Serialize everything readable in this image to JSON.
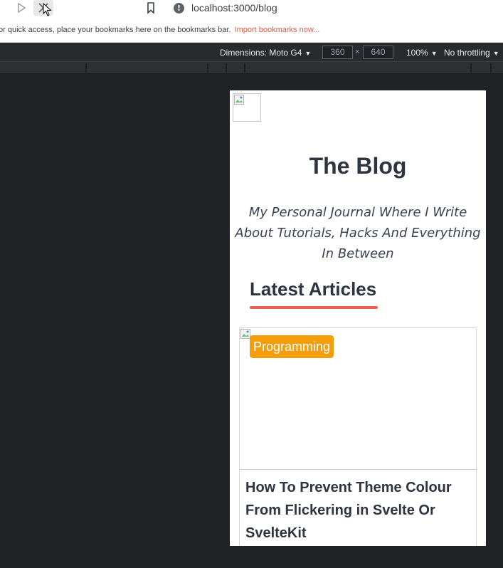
{
  "browser": {
    "url": "localhost:3000/blog",
    "bookmarks_bar_text": "or quick access, place your bookmarks here on the bookmarks bar.",
    "bookmarks_bar_link": "Import bookmarks now..."
  },
  "device_toolbar": {
    "dimensions_label": "Dimensions: Moto G4",
    "width_value": "360",
    "height_value": "640",
    "times": "×",
    "zoom": "100%",
    "throttling": "No throttling"
  },
  "page": {
    "title": "The Blog",
    "subtitle": "My Personal Journal Where I Write About Tutorials, Hacks And Everything In Between",
    "section_title": "Latest Articles",
    "articles": [
      {
        "tag": "Programming",
        "title": "How To Prevent Theme Colour From Flickering in Svelte Or SvelteKit"
      }
    ]
  },
  "colors": {
    "accent_underline": "#e8604c",
    "tag_background": "#f59e0b",
    "link_red": "#e8573d"
  },
  "icons": [
    "play-icon",
    "close-icon",
    "bookmark-icon",
    "info-icon",
    "mouse-cursor-icon",
    "broken-image-icon"
  ]
}
